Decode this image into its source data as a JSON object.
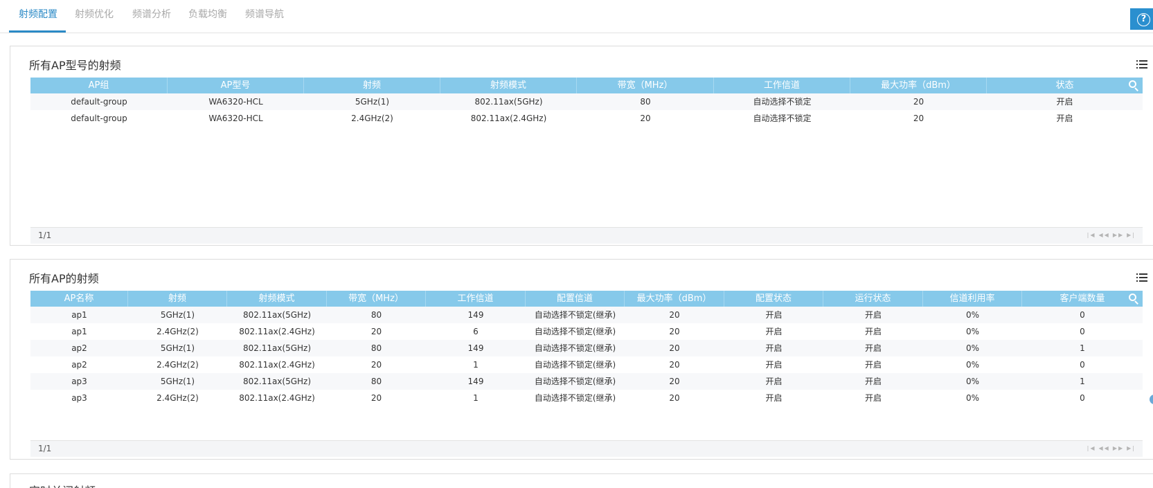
{
  "tabs": [
    {
      "label": "射频配置"
    },
    {
      "label": "射频优化"
    },
    {
      "label": "频谱分析"
    },
    {
      "label": "负载均衡"
    },
    {
      "label": "频谱导航"
    }
  ],
  "help_label": "?",
  "panel1": {
    "title": "所有AP型号的射频",
    "columns": [
      "AP组",
      "AP型号",
      "射频",
      "射频模式",
      "带宽（MHz）",
      "工作信道",
      "最大功率（dBm）",
      "状态"
    ],
    "rows": [
      [
        "default-group",
        "WA6320-HCL",
        "5GHz(1)",
        "802.11ax(5GHz)",
        "80",
        "自动选择不锁定",
        "20",
        "开启"
      ],
      [
        "default-group",
        "WA6320-HCL",
        "2.4GHz(2)",
        "802.11ax(2.4GHz)",
        "20",
        "自动选择不锁定",
        "20",
        "开启"
      ]
    ],
    "pager": "1/1"
  },
  "panel2": {
    "title": "所有AP的射频",
    "columns": [
      "AP名称",
      "射频",
      "射频模式",
      "带宽（MHz）",
      "工作信道",
      "配置信道",
      "最大功率（dBm）",
      "配置状态",
      "运行状态",
      "信道利用率",
      "客户端数量"
    ],
    "rows": [
      [
        "ap1",
        "5GHz(1)",
        "802.11ax(5GHz)",
        "80",
        "149",
        "自动选择不锁定(继承)",
        "20",
        "开启",
        "开启",
        "0%",
        "0"
      ],
      [
        "ap1",
        "2.4GHz(2)",
        "802.11ax(2.4GHz)",
        "20",
        "6",
        "自动选择不锁定(继承)",
        "20",
        "开启",
        "开启",
        "0%",
        "0"
      ],
      [
        "ap2",
        "5GHz(1)",
        "802.11ax(5GHz)",
        "80",
        "149",
        "自动选择不锁定(继承)",
        "20",
        "开启",
        "开启",
        "0%",
        "1"
      ],
      [
        "ap2",
        "2.4GHz(2)",
        "802.11ax(2.4GHz)",
        "20",
        "1",
        "自动选择不锁定(继承)",
        "20",
        "开启",
        "开启",
        "0%",
        "0"
      ],
      [
        "ap3",
        "5GHz(1)",
        "802.11ax(5GHz)",
        "80",
        "149",
        "自动选择不锁定(继承)",
        "20",
        "开启",
        "开启",
        "0%",
        "1"
      ],
      [
        "ap3",
        "2.4GHz(2)",
        "802.11ax(2.4GHz)",
        "20",
        "1",
        "自动选择不锁定(继承)",
        "20",
        "开启",
        "开启",
        "0%",
        "0"
      ]
    ],
    "pager": "1/1"
  },
  "panel3": {
    "title": "定时关闭射频"
  },
  "pager_buttons": [
    "first-page",
    "prev-page",
    "next-page",
    "last-page"
  ]
}
